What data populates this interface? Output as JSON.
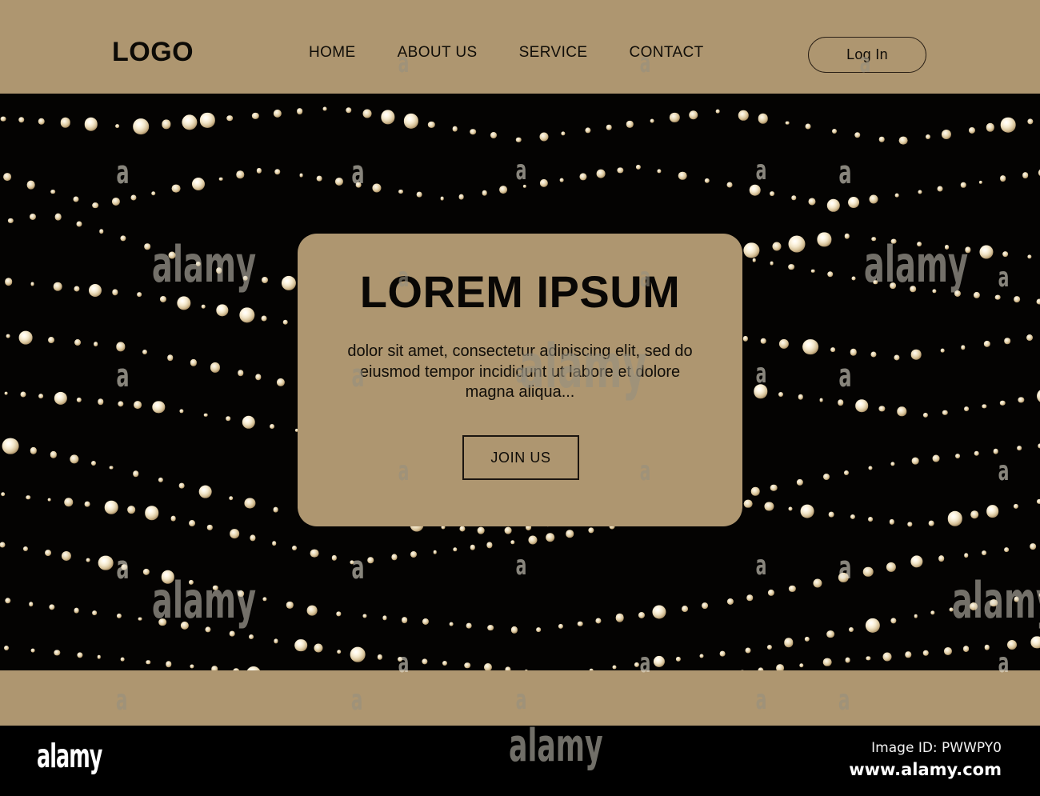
{
  "theme": {
    "tan": "#ae9670",
    "dark": "#040302",
    "ink": "#0c0a06",
    "bead_core": "#fffaf0",
    "bead_mid": "#d9c49a"
  },
  "header": {
    "logo": "LOGO",
    "nav": [
      {
        "label": "HOME",
        "name": "nav-item-home"
      },
      {
        "label": "ABOUT US",
        "name": "nav-item-about-us"
      },
      {
        "label": "SERVICE",
        "name": "nav-item-service"
      },
      {
        "label": "CONTACT",
        "name": "nav-item-contact"
      }
    ],
    "login_label": "Log In"
  },
  "hero": {
    "title": "LOREM IPSUM",
    "subtitle": "dolor sit amet, consectetur adipiscing elit, sed do eiusmod tempor incididunt ut labore et dolore magna aliqua...",
    "cta_label": "JOIN US"
  },
  "watermark": {
    "letter": "a",
    "word": "alamy"
  },
  "attribution": {
    "logo": "alamy",
    "image_id": "Image ID: PWWPY0",
    "url": "www.alamy.com"
  }
}
